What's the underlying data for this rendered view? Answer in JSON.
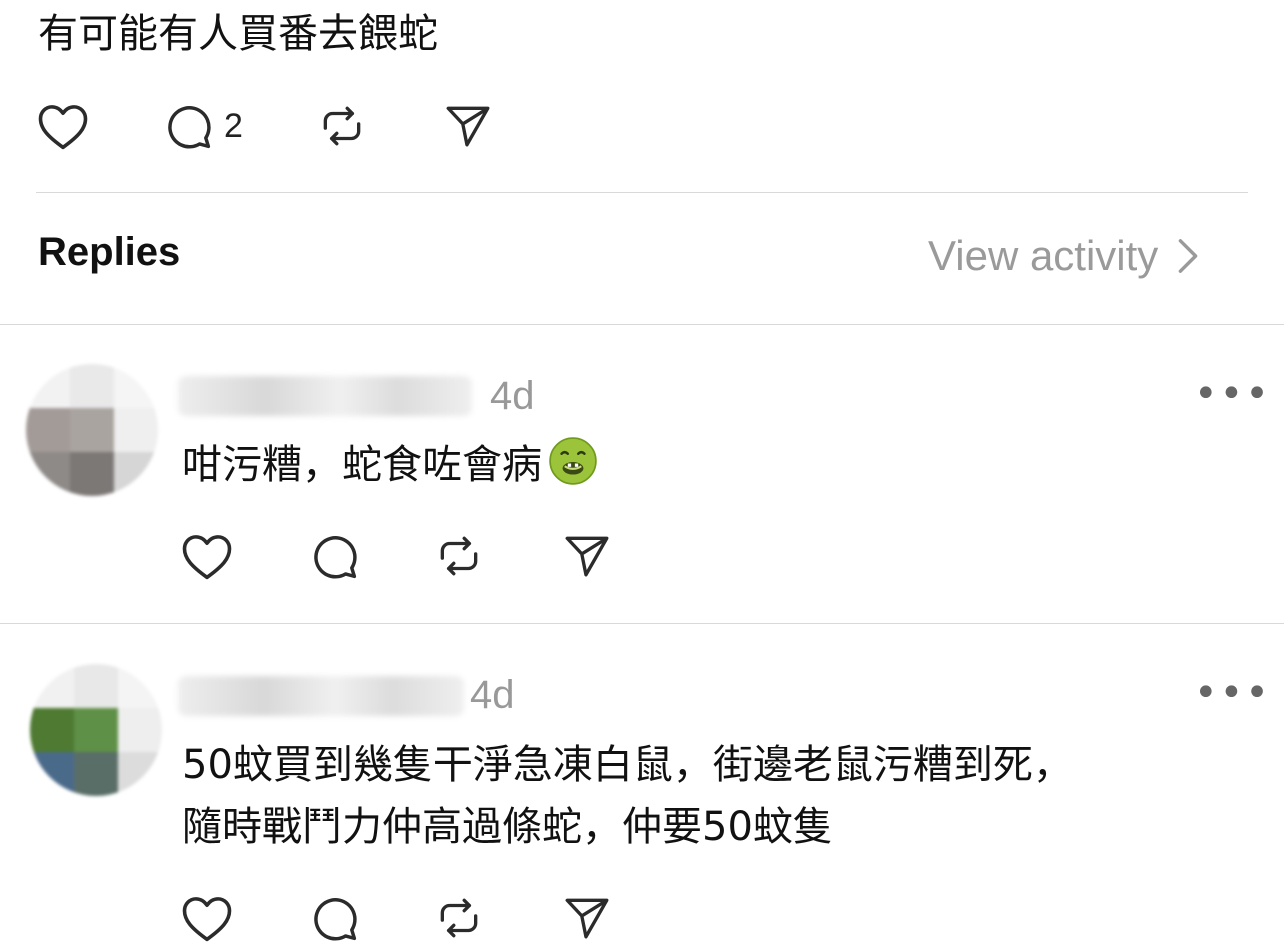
{
  "post": {
    "text": "有可能有人買番去餵蛇",
    "reply_count": "2"
  },
  "replies_header": {
    "title": "Replies",
    "view_activity": "View activity"
  },
  "replies": [
    {
      "time": "4d",
      "text": "咁污糟，蛇食咗會病",
      "emoji": "nauseated-face-emoji",
      "avatar_colors": [
        "#f2f2f2",
        "#e9e9e9",
        "#f5f5f5",
        "#a39b98",
        "#aaa4a0",
        "#efefef",
        "#8e8a88",
        "#7c7876",
        "#d6d6d6"
      ]
    },
    {
      "time": "4d",
      "text_line1": "50蚊買到幾隻干淨急凍白鼠，街邊老鼠污糟到死，",
      "text_line2": "隨時戰鬥力仲高過條蛇，仲要50蚊隻",
      "avatar_colors": [
        "#f1f1f1",
        "#e8e8e8",
        "#f4f4f4",
        "#4e7a32",
        "#5f9048",
        "#eeeeee",
        "#4a6a8a",
        "#5a6e68",
        "#dcdcdc"
      ]
    }
  ],
  "colors": {
    "icon": "#2b2b2b",
    "muted_text": "#9a9a9a",
    "divider": "#d9d9d9"
  }
}
